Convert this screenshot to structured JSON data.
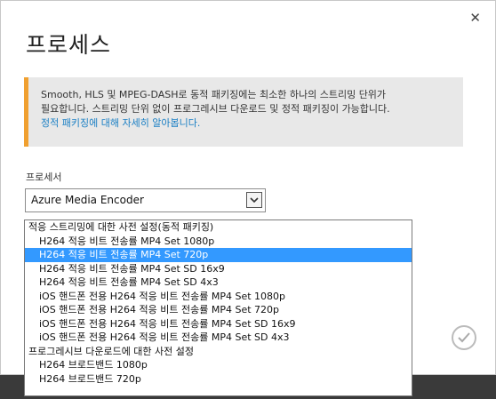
{
  "dialog": {
    "title": "프로세스",
    "notice": {
      "line1": "Smooth, HLS 및 MPEG-DASH로 동적 패키징에는 최소한 하나의 스트리밍 단위가",
      "line2": "필요합니다. 스트리밍 단위 없이 프로그레시브 다운로드 및 정적 패키징이 가능합니다.",
      "link": "정적 패키징에 대해 자세히 알아봅니다."
    },
    "processor_label": "프로세서",
    "processor_value": "Azure Media Encoder"
  },
  "dropdown": {
    "items": [
      {
        "text": "적응 스트리밍에 대한 사전 설정(동적 패키징)",
        "kind": "group"
      },
      {
        "text": "H264 적응 비트 전송률 MP4 Set 1080p",
        "kind": "opt"
      },
      {
        "text": "H264 적응 비트 전송률 MP4 Set 720p",
        "kind": "opt",
        "selected": true
      },
      {
        "text": "H264 적응 비트 전송률 MP4 Set SD 16x9",
        "kind": "opt"
      },
      {
        "text": "H264 적응 비트 전송률 MP4 Set SD 4x3",
        "kind": "opt"
      },
      {
        "text": "iOS 핸드폰 전용 H264 적응 비트 전송률 MP4 Set 1080p",
        "kind": "opt"
      },
      {
        "text": "iOS 핸드폰 전용 H264 적응 비트 전송률 MP4 Set 720p",
        "kind": "opt"
      },
      {
        "text": "iOS 핸드폰 전용 H264 적응 비트 전송률 MP4 Set SD 16x9",
        "kind": "opt"
      },
      {
        "text": "iOS 핸드폰 전용 H264 적응 비트 전송률 MP4 Set SD 4x3",
        "kind": "opt"
      },
      {
        "text": "프로그레시브 다운로드에 대한 사전 설정",
        "kind": "group"
      },
      {
        "text": "H264 브로드밴드 1080p",
        "kind": "opt"
      },
      {
        "text": "H264 브로드밴드 720p",
        "kind": "opt"
      }
    ]
  },
  "colors": {
    "accent_border": "#f0a030",
    "link": "#1a7fc4",
    "selection": "#3399ff"
  },
  "icons": {
    "close": "close-icon",
    "confirm": "checkmark-icon",
    "dropdown": "chevron-down-icon"
  }
}
